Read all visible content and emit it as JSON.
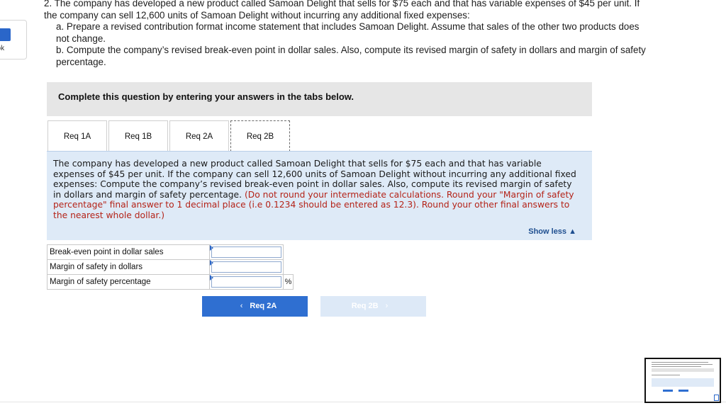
{
  "sidebar": {
    "ebook_label": "ook"
  },
  "question": {
    "stem": "2. The company has developed a new product called Samoan Delight that sells for $75 each and that has variable expenses of $45 per unit. If the company can sell 12,600 units of Samoan Delight without incurring any additional fixed expenses:",
    "part_a": "a. Prepare a revised contribution format income statement that includes Samoan Delight. Assume that sales of the other two products does not change.",
    "part_b": "b. Compute the company’s revised break-even point in dollar sales. Also, compute its revised margin of safety in dollars and margin of safety percentage."
  },
  "banner": {
    "text": "Complete this question by entering your answers in the tabs below."
  },
  "tabs": [
    {
      "label": "Req 1A"
    },
    {
      "label": "Req 1B"
    },
    {
      "label": "Req 2A"
    },
    {
      "label": "Req 2B"
    }
  ],
  "active_tab": "Req 2B",
  "panel": {
    "instructions": "The company has developed a new product called Samoan Delight that sells for $75 each and that has variable expenses of $45 per unit. If the company can sell 12,600 units of Samoan Delight without incurring any additional fixed expenses: Compute the company’s revised break-even point in dollar sales. Also, compute its revised margin of safety in dollars and margin of safety percentage.",
    "note": "(Do not round your intermediate calculations. Round your \"Margin of safety percentage\" final answer to 1 decimal place (i.e 0.1234 should be entered as 12.3). Round your other final answers to the nearest whole dollar.)",
    "toggle": "Show less ▲"
  },
  "answers": {
    "rows": [
      {
        "label": "Break-even point in dollar sales",
        "value": "",
        "unit": ""
      },
      {
        "label": "Margin of safety in dollars",
        "value": "",
        "unit": ""
      },
      {
        "label": "Margin of safety percentage",
        "value": "",
        "unit": "%"
      }
    ]
  },
  "nav": {
    "prev_label": "Req 2A",
    "next_label": "Req 2B",
    "prev_arrow": "‹",
    "next_arrow": "›"
  },
  "colors": {
    "primary": "#2f6fd1",
    "panel_bg": "#deeaf7",
    "banner_bg": "#e6e6e6",
    "note_red": "#b42318",
    "link_blue": "#1e4e8f"
  }
}
